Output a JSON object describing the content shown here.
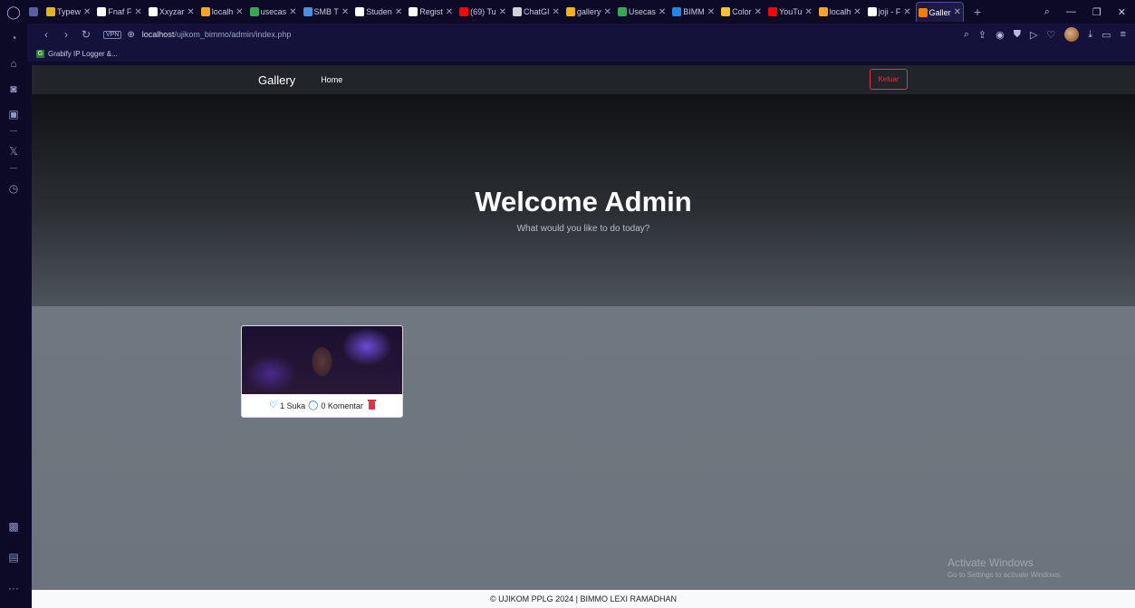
{
  "browser": {
    "tabs": [
      {
        "label": "",
        "icon": "tab-grid-icon",
        "color": "#5a5fa0"
      },
      {
        "label": "Typew",
        "icon": "monkeytype-icon",
        "color": "#e2b714"
      },
      {
        "label": "Fnaf F",
        "icon": "web-icon",
        "color": "#ffffff"
      },
      {
        "label": "Xxyzar",
        "icon": "github-icon",
        "color": "#ffffff"
      },
      {
        "label": "localh",
        "icon": "xampp-icon",
        "color": "#f5a623"
      },
      {
        "label": "usecas",
        "icon": "drive-icon",
        "color": "#34a853"
      },
      {
        "label": "SMB T",
        "icon": "u-icon",
        "color": "#4a90e2"
      },
      {
        "label": "Studen",
        "icon": "web-icon",
        "color": "#ffffff"
      },
      {
        "label": "Regist",
        "icon": "web-icon",
        "color": "#ffffff"
      },
      {
        "label": "(69) Tu",
        "icon": "youtube-icon",
        "color": "#ff0000"
      },
      {
        "label": "ChatGI",
        "icon": "chatgpt-icon",
        "color": "#cfd2d6"
      },
      {
        "label": "gallery",
        "icon": "gallery-icon",
        "color": "#f4b400"
      },
      {
        "label": "Usecas",
        "icon": "drive-icon",
        "color": "#34a853"
      },
      {
        "label": "BIMM",
        "icon": "trello-icon",
        "color": "#1e88e5"
      },
      {
        "label": "Color",
        "icon": "color-icon",
        "color": "#fbc02d"
      },
      {
        "label": "YouTu",
        "icon": "youtube-icon",
        "color": "#ff0000"
      },
      {
        "label": "localh",
        "icon": "xampp-icon",
        "color": "#f5a623"
      },
      {
        "label": "joji - F",
        "icon": "google-icon",
        "color": "#ffffff"
      },
      {
        "label": "Galler",
        "icon": "gallery-icon",
        "color": "#f57c00",
        "active": true
      }
    ],
    "url_host": "localhost",
    "url_path": "/ujikom_bimmo/admin/index.php",
    "vpn_label": "VPN",
    "bookmark_label": "Grabify IP Logger &..."
  },
  "page": {
    "brand": "Gallery",
    "nav_home": "Home",
    "logout_label": "Keluar",
    "hero_title": "Welcome Admin",
    "hero_subtitle": "What would you like to do today?",
    "cards": [
      {
        "likes_text": "1 Suka",
        "comments_text": "0 Komentar"
      }
    ],
    "footer": "© UJIKOM PPLG 2024 | BIMMO LEXI RAMADHAN"
  },
  "overlay": {
    "activate_title": "Activate Windows",
    "activate_sub": "Go to Settings to activate Windows."
  },
  "colors": {
    "danger": "#dc3545",
    "primary": "#0d6efd",
    "navbar": "#212529"
  }
}
